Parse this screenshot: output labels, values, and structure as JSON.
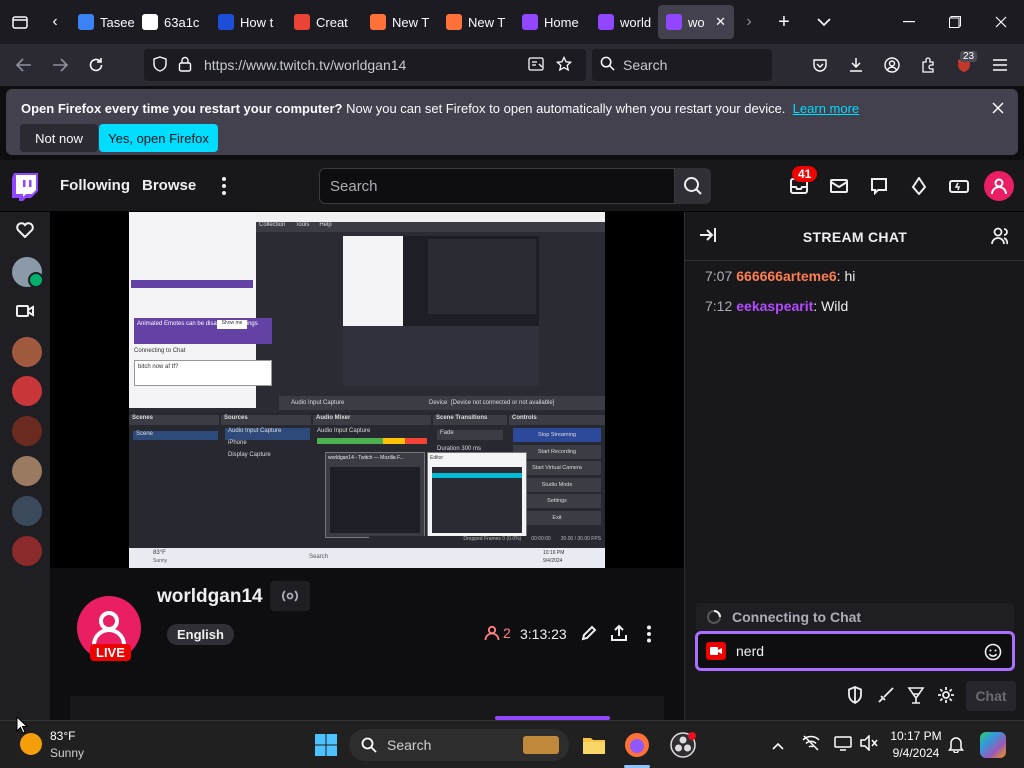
{
  "browser": {
    "tabs": [
      {
        "label": "Taseen",
        "fav_color": "#3b82f6"
      },
      {
        "label": "63a1c",
        "fav_color": "#ffffff"
      },
      {
        "label": "How t",
        "fav_color": "#1d4ed8"
      },
      {
        "label": "Creat",
        "fav_color": "#ea4335"
      },
      {
        "label": "New T",
        "fav_color": "#ff7139"
      },
      {
        "label": "New T",
        "fav_color": "#ff7139"
      },
      {
        "label": "Home",
        "fav_color": "#9146ff"
      },
      {
        "label": "world",
        "fav_color": "#9146ff"
      },
      {
        "label": "wo",
        "fav_color": "#9146ff"
      }
    ],
    "url": "https://www.twitch.tv/worldgan14",
    "search_placeholder": "Search",
    "extensions_badge": "23"
  },
  "notification": {
    "bold": "Open Firefox every time you restart your computer?",
    "text": " Now you can set Firefox to open automatically when you restart your device.",
    "link": "Learn more",
    "not_now": "Not now",
    "yes_open": "Yes, open Firefox"
  },
  "twitch": {
    "nav": {
      "following": "Following",
      "browse": "Browse",
      "search_placeholder": "Search",
      "notif_count": "41"
    },
    "channel": {
      "name": "worldgan14",
      "language": "English",
      "live": "LIVE",
      "viewers": "2",
      "uptime": "3:13:23"
    },
    "chat": {
      "title": "STREAM CHAT",
      "messages": [
        {
          "time": "7:07",
          "user": "666666arteme6",
          "user_color": "#ff7f50",
          "text": "hi"
        },
        {
          "time": "7:12",
          "user": "eekaspearit",
          "user_color": "#b44bff",
          "text": "Wild"
        }
      ],
      "connecting": "Connecting to Chat",
      "input_value": "nerd",
      "send": "Chat"
    },
    "stream_screen": {
      "notice_text": "Animated Emotes can be disabled in Settings",
      "notice_btn": "Show me",
      "connecting": "Connecting to Chat",
      "chat_input": "bitch now af tf?",
      "panels": [
        "Scenes",
        "Sources",
        "Audio Mixer",
        "Scene Transitions",
        "Controls"
      ],
      "scene": "Scene",
      "sources": [
        "Audio Input Capture",
        "iPhone",
        "Display Capture"
      ],
      "controls": [
        "Stop Streaming",
        "Start Recording",
        "Start Virtual Camera",
        "Studio Mode",
        "Settings",
        "Exit"
      ],
      "mixer_track": "Audio Input Capture",
      "transition": "Fade",
      "duration_label": "Duration",
      "duration": "300 ms",
      "menu": [
        "Collection",
        "Tools",
        "Help"
      ],
      "device_label": "Device",
      "device_value": "[Device not connected or not available]",
      "audio_cap": "Audio Input Capture",
      "popup1": "worldgan14 - Twitch — Mozilla F...",
      "popup2": "Editor",
      "taskbar_weather": "83°F",
      "taskbar_weather_sub": "Sunny",
      "taskbar_search": "Search",
      "taskbar_time": "10:16 PM",
      "taskbar_date": "9/4/2024",
      "status_time": "00:00:00",
      "status_fps": "30.00 / 30.00 FPS",
      "status_text": "Dropped Frames 0 (0.0%)"
    }
  },
  "taskbar": {
    "weather_temp": "83°F",
    "weather_desc": "Sunny",
    "search_label": "Search",
    "time": "10:17 PM",
    "date": "9/4/2024"
  }
}
